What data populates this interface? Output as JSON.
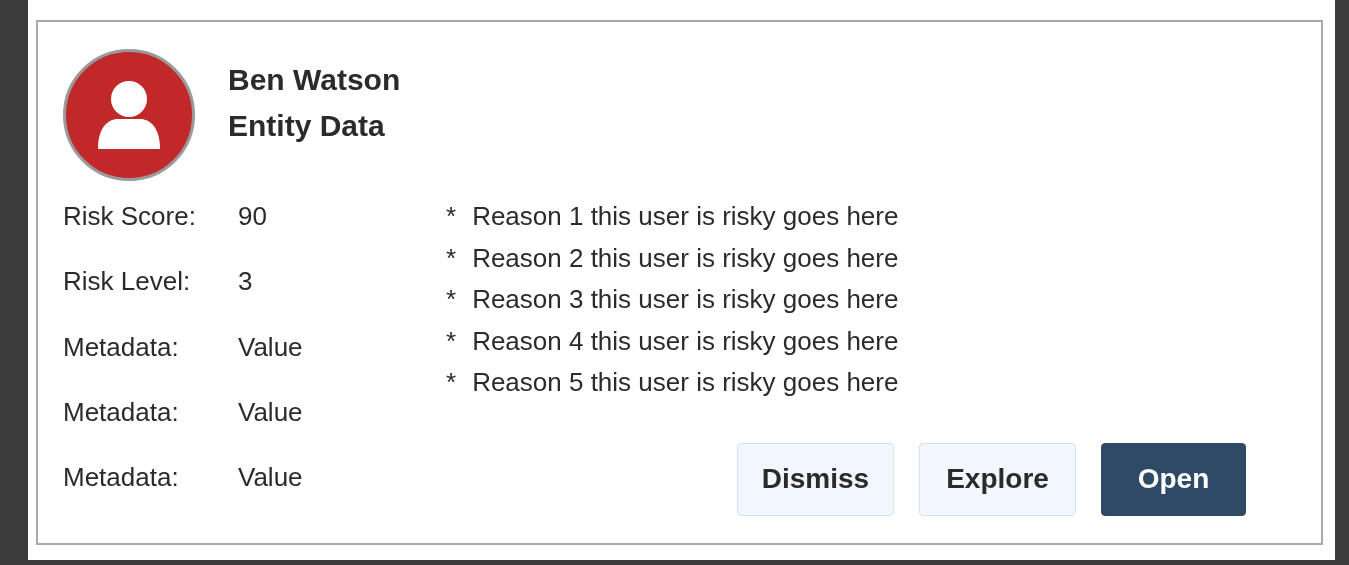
{
  "person": {
    "name": "Ben Watson",
    "subtitle": "Entity Data"
  },
  "fields": [
    {
      "label": "Risk Score:",
      "value": "90"
    },
    {
      "label": "Risk Level:",
      "value": "3"
    },
    {
      "label": "Metadata:",
      "value": "Value"
    },
    {
      "label": "Metadata:",
      "value": "Value"
    },
    {
      "label": "Metadata:",
      "value": "Value"
    }
  ],
  "reasons": [
    {
      "bullet": "*",
      "text": "Reason 1 this user is risky goes here"
    },
    {
      "bullet": "*",
      "text": "Reason 2 this user is risky goes here"
    },
    {
      "bullet": "*",
      "text": "Reason 3 this user is risky goes here"
    },
    {
      "bullet": "*",
      "text": "Reason 4 this user is risky goes here"
    },
    {
      "bullet": "*",
      "text": "Reason 5 this user is risky goes here"
    }
  ],
  "buttons": [
    {
      "label": "Dismiss",
      "kind": "secondary"
    },
    {
      "label": "Explore",
      "kind": "secondary"
    },
    {
      "label": "Open",
      "kind": "primary"
    }
  ]
}
